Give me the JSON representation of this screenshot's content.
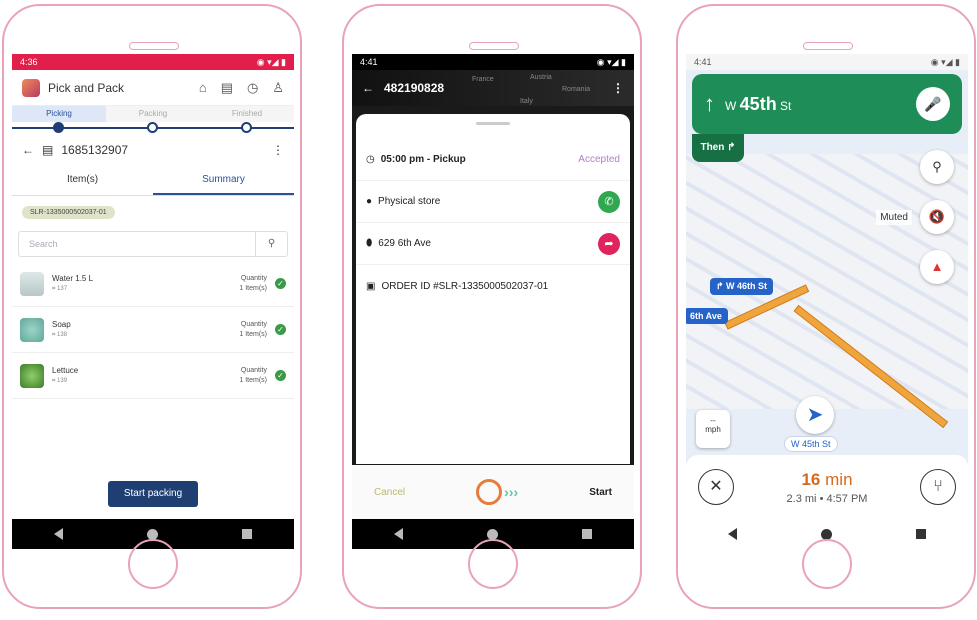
{
  "phone1": {
    "status_time": "4:36",
    "app_title": "Pick and Pack",
    "steps": [
      "Picking",
      "Packing",
      "Finished"
    ],
    "order_number": "1685132907",
    "tabs": [
      "Item(s)",
      "Summary"
    ],
    "order_chip": "SLR-1335000502037-01",
    "search_placeholder": "Search",
    "items": [
      {
        "name": "Water 1.5 L",
        "code": "137",
        "qty_label": "Quantity",
        "qty_value": "1 Item(s)"
      },
      {
        "name": "Soap",
        "code": "138",
        "qty_label": "Quantity",
        "qty_value": "1 Item(s)"
      },
      {
        "name": "Lettuce",
        "code": "139",
        "qty_label": "Quantity",
        "qty_value": "1 Item(s)"
      }
    ],
    "start_button": "Start packing"
  },
  "phone2": {
    "status_time": "4:41",
    "order_id": "482190828",
    "map_labels": [
      "France",
      "Austria",
      "Italy",
      "Romania"
    ],
    "pickup_time": "05:00 pm - Pickup",
    "status": "Accepted",
    "store": "Physical store",
    "address": "629 6th Ave",
    "order_ref": "ORDER ID #SLR-1335000502037-01",
    "cancel": "Cancel",
    "start": "Start"
  },
  "phone3": {
    "status_time": "4:41",
    "street_prefix": "W",
    "street_main": "45th",
    "street_suffix": "St",
    "then_label": "Then",
    "muted_label": "Muted",
    "next_street": "W 46th St",
    "side_street": "6th Ave",
    "speed_unit": "mph",
    "speed_value": "--",
    "current_street": "W 45th St",
    "eta_minutes": "16",
    "eta_unit": "min",
    "distance": "2.3 mi",
    "arrival": "4:57 PM",
    "colors": {
      "nav_green": "#1e8d57",
      "route_orange": "#f0a53c",
      "eta_orange": "#d66a1c"
    }
  }
}
